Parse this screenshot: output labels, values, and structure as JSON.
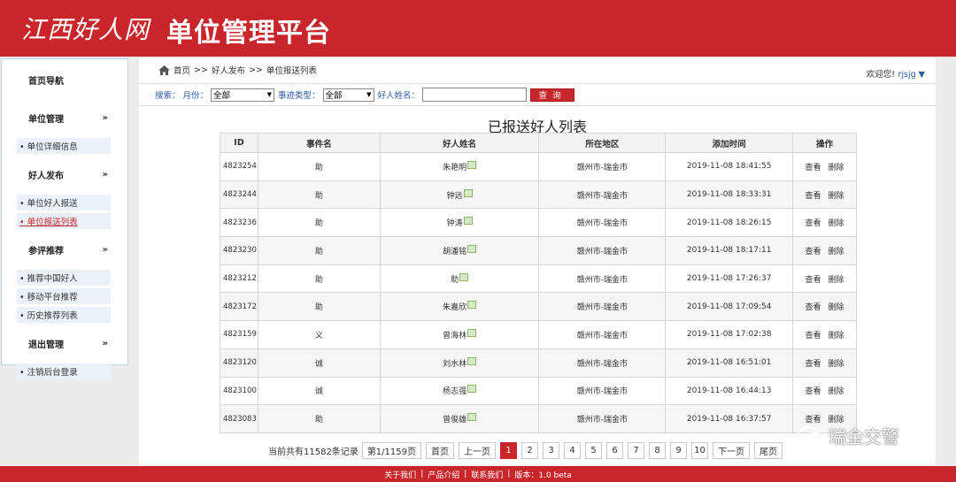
{
  "header": {
    "logo_script": "江西好人网",
    "title": "单位管理平台"
  },
  "sidebar": {
    "top": "首页导航",
    "groups": [
      {
        "title": "单位管理",
        "items": [
          "• 单位详细信息"
        ]
      },
      {
        "title": "好人发布",
        "items": [
          "• 单位好人报送",
          "• 单位报送列表"
        ]
      },
      {
        "title": "参评推荐",
        "items": [
          "• 推荐中国好人",
          "• 移动平台推荐",
          "• 历史推荐列表"
        ]
      },
      {
        "title": "退出管理",
        "items": [
          "• 注销后台登录"
        ]
      }
    ],
    "chevron": "»"
  },
  "breadcrumb": {
    "home": "首页",
    "sep": ">>",
    "level1": "好人发布",
    "level2": "单位报送列表"
  },
  "welcome": "欢迎您!",
  "user": "rjsjg ▼",
  "search": {
    "label": "搜索：",
    "month_label": "月份：",
    "month_value": "全部",
    "type_label": "事迹类型：",
    "type_value": "全部",
    "name_label": "好人姓名：",
    "name_value": "",
    "button": "查询"
  },
  "list_title": "已报送好人列表",
  "table": {
    "headers": [
      "ID",
      "事件名",
      "好人姓名",
      "所在地区",
      "添加时间",
      "操作"
    ],
    "view_label": "查看",
    "delete_label": "删除",
    "rows": [
      {
        "id": "4823254",
        "event": "助",
        "name": "朱艳明",
        "region": "赣州市-瑞金市",
        "time": "2019-11-08 18:41:55"
      },
      {
        "id": "4823244",
        "event": "助",
        "name": "钟远",
        "region": "赣州市-瑞金市",
        "time": "2019-11-08 18:33:31"
      },
      {
        "id": "4823236",
        "event": "助",
        "name": "钟涛",
        "region": "赣州市-瑞金市",
        "time": "2019-11-08 18:26:15"
      },
      {
        "id": "4823230",
        "event": "助",
        "name": "胡潘铭",
        "region": "赣州市-瑞金市",
        "time": "2019-11-08 18:17:11"
      },
      {
        "id": "4823212",
        "event": "助",
        "name": "助",
        "region": "赣州市-瑞金市",
        "time": "2019-11-08 17:26:37"
      },
      {
        "id": "4823172",
        "event": "助",
        "name": "朱嘉欣",
        "region": "赣州市-瑞金市",
        "time": "2019-11-08 17:09:54"
      },
      {
        "id": "4823159",
        "event": "义",
        "name": "曾海林",
        "region": "赣州市-瑞金市",
        "time": "2019-11-08 17:02:38"
      },
      {
        "id": "4823120",
        "event": "诚",
        "name": "刘水林",
        "region": "赣州市-瑞金市",
        "time": "2019-11-08 16:51:01"
      },
      {
        "id": "4823100",
        "event": "诚",
        "name": "杨志强",
        "region": "赣州市-瑞金市",
        "time": "2019-11-08 16:44:13"
      },
      {
        "id": "4823083",
        "event": "助",
        "name": "曾俊雄",
        "region": "赣州市-瑞金市",
        "time": "2019-11-08 16:37:57"
      }
    ]
  },
  "pager": {
    "info": "当前共有11582条记录",
    "page_info": "第1/1159页",
    "first": "首页",
    "prev": "上一页",
    "pages": [
      "1",
      "2",
      "3",
      "4",
      "5",
      "6",
      "7",
      "8",
      "9",
      "10"
    ],
    "current": "1",
    "next": "下一页",
    "last": "尾页"
  },
  "footer": {
    "about": "关于我们",
    "product": "产品介绍",
    "contact": "联系我们",
    "version": "版本：1.0 beta",
    "sep": "|"
  },
  "watermark": "瑞金交警",
  "colors": {
    "brand_red": "#c8262b",
    "link_blue": "#2a5aa8"
  }
}
